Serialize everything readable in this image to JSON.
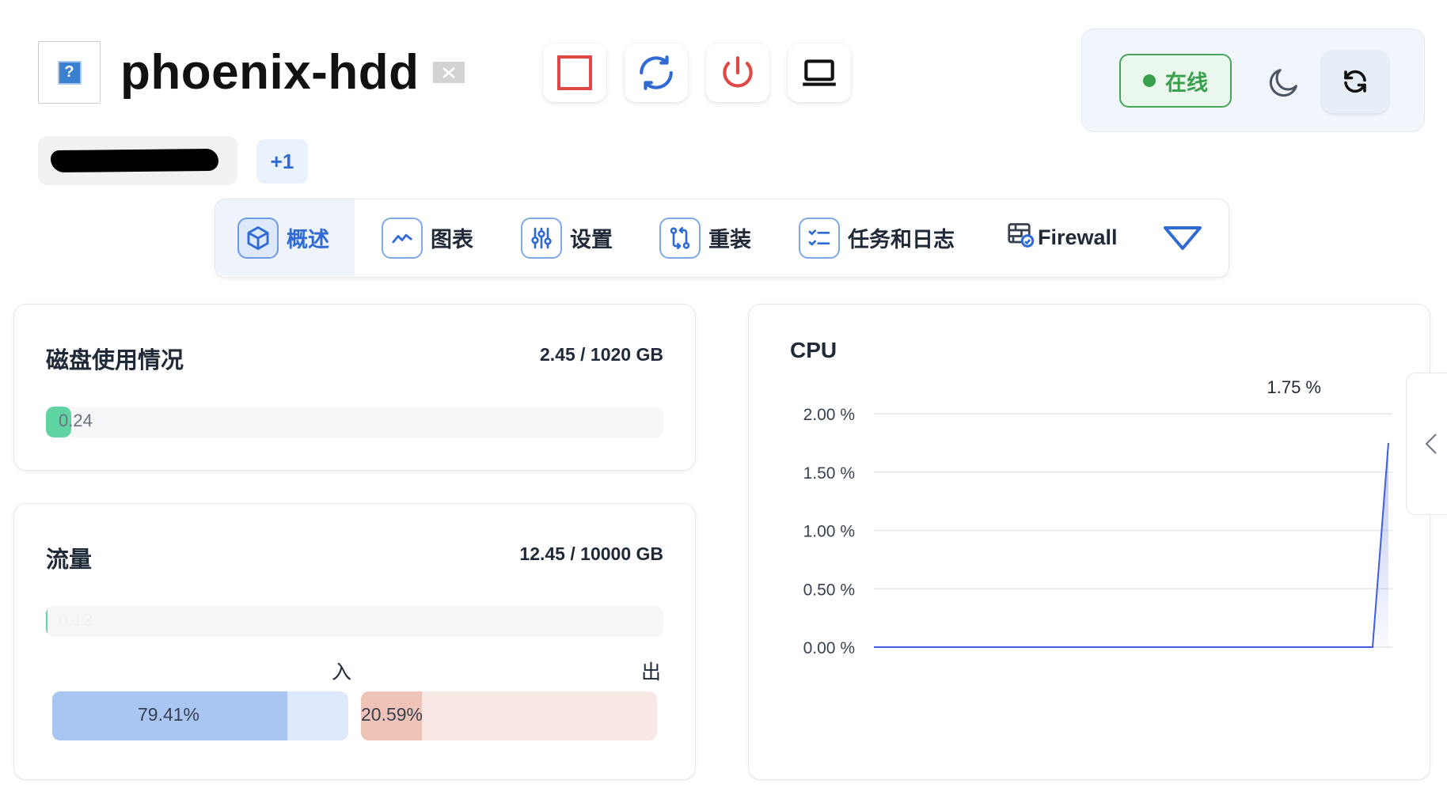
{
  "header": {
    "server_name": "phoenix-hdd",
    "favicon_icon": "missing-image-icon",
    "flag_icon": "close-flag-icon",
    "toolbar": [
      {
        "name": "stop",
        "icon": "stop-square-icon",
        "color": "#e04848"
      },
      {
        "name": "restart",
        "icon": "refresh-arrows-icon",
        "color": "#2f6ad6"
      },
      {
        "name": "power",
        "icon": "power-icon",
        "color": "#e04848"
      },
      {
        "name": "console",
        "icon": "laptop-icon",
        "color": "#111111"
      }
    ]
  },
  "status": {
    "label": "在线",
    "color": "#38a04c"
  },
  "tags": {
    "more_count": "+1"
  },
  "tabs": [
    {
      "label": "概述",
      "icon": "cube-icon",
      "active": true
    },
    {
      "label": "图表",
      "icon": "chart-line-icon",
      "active": false
    },
    {
      "label": "设置",
      "icon": "sliders-icon",
      "active": false
    },
    {
      "label": "重装",
      "icon": "git-compare-icon",
      "active": false
    },
    {
      "label": "任务和日志",
      "icon": "checklist-icon",
      "active": false
    },
    {
      "label": "Firewall",
      "icon": "firewall-icon",
      "active": false
    }
  ],
  "disk": {
    "title": "磁盘使用情况",
    "value": "2.45 / 1020 GB",
    "percent_label": "0.24",
    "percent": 0.24
  },
  "traffic": {
    "title": "流量",
    "value": "12.45 / 10000 GB",
    "percent_label": "0.12",
    "percent": 0.12,
    "in_label": "入",
    "out_label": "出",
    "in_percent_label": "79.41%",
    "in_percent": 79.41,
    "out_percent_label": "20.59%",
    "out_percent": 20.59
  },
  "cpu": {
    "title": "CPU",
    "current_label": "1.75 %"
  },
  "chart_data": {
    "type": "area",
    "title": "CPU",
    "y_ticks": [
      "2.00 %",
      "1.50 %",
      "1.00 %",
      "0.50 %",
      "0.00 %"
    ],
    "ylim": [
      0,
      2
    ],
    "grid": true,
    "series": [
      {
        "values": [
          0,
          0,
          0,
          0,
          0,
          0,
          0,
          0,
          0,
          0,
          0,
          0,
          0,
          0,
          0,
          0,
          0,
          0,
          0,
          0,
          0,
          0,
          0,
          0,
          0,
          0,
          0,
          0,
          0,
          1.75
        ]
      }
    ],
    "line_color": "#3f5ee0"
  }
}
